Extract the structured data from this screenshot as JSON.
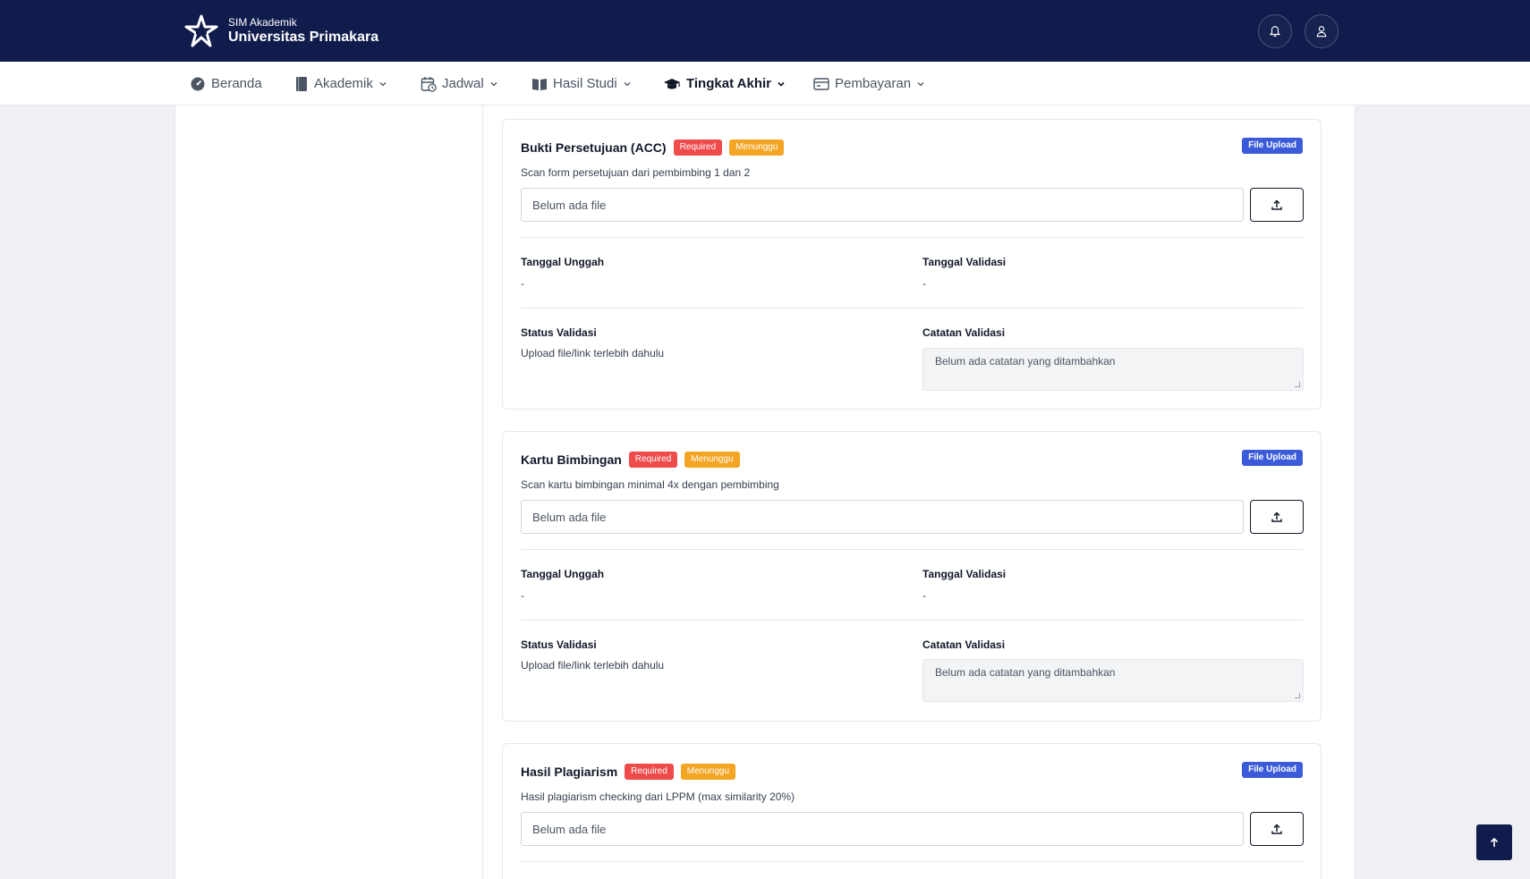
{
  "header": {
    "subtitle": "SIM Akademik",
    "title": "Universitas Primakara"
  },
  "nav": [
    {
      "label": "Beranda"
    },
    {
      "label": "Akademik"
    },
    {
      "label": "Jadwal"
    },
    {
      "label": "Hasil Studi"
    },
    {
      "label": "Tingkat Akhir"
    },
    {
      "label": "Pembayaran"
    }
  ],
  "cards": [
    {
      "title": "Bukti Persetujuan (ACC)",
      "badge_required": "Required",
      "badge_status": "Menunggu",
      "badge_type": "File Upload",
      "description": "Scan form persetujuan dari pembimbing 1 dan 2",
      "file_value": "Belum ada file",
      "tanggal_unggah_label": "Tanggal Unggah",
      "tanggal_unggah_value": "-",
      "tanggal_validasi_label": "Tanggal Validasi",
      "tanggal_validasi_value": "-",
      "status_label": "Status Validasi",
      "status_value": "Upload file/link terlebih dahulu",
      "catatan_label": "Catatan Validasi",
      "catatan_value": "Belum ada catatan yang ditambahkan"
    },
    {
      "title": "Kartu Bimbingan",
      "badge_required": "Required",
      "badge_status": "Menunggu",
      "badge_type": "File Upload",
      "description": "Scan kartu bimbingan minimal 4x dengan pembimbing",
      "file_value": "Belum ada file",
      "tanggal_unggah_label": "Tanggal Unggah",
      "tanggal_unggah_value": "-",
      "tanggal_validasi_label": "Tanggal Validasi",
      "tanggal_validasi_value": "-",
      "status_label": "Status Validasi",
      "status_value": "Upload file/link terlebih dahulu",
      "catatan_label": "Catatan Validasi",
      "catatan_value": "Belum ada catatan yang ditambahkan"
    },
    {
      "title": "Hasil Plagiarism",
      "badge_required": "Required",
      "badge_status": "Menunggu",
      "badge_type": "File Upload",
      "description": "Hasil plagiarism checking dari LPPM (max similarity 20%)",
      "file_value": "Belum ada file"
    }
  ],
  "colors": {
    "header_bg": "#101c4c",
    "badge_required": "#ef4b4b",
    "badge_status": "#f5a524",
    "badge_type": "#3b5bdb"
  },
  "icons": {
    "logo": "star-logo-icon",
    "bell": "bell-icon",
    "user": "user-icon",
    "upload": "upload-icon",
    "scroll_top": "arrow-up-icon"
  }
}
